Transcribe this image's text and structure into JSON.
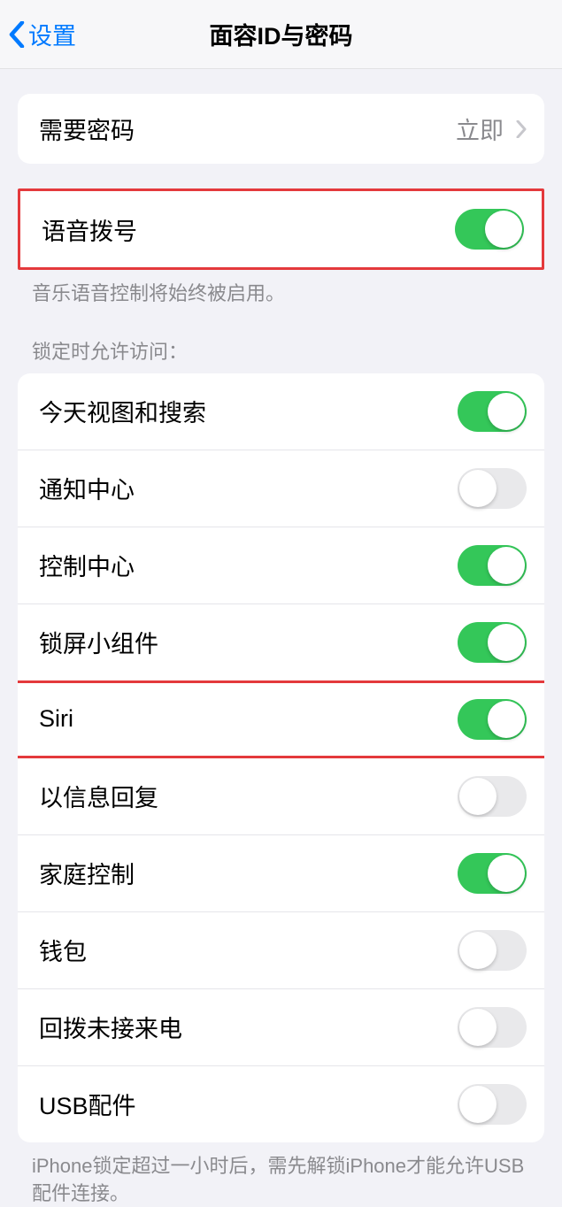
{
  "nav": {
    "back": "设置",
    "title": "面容ID与密码"
  },
  "passcode_row": {
    "label": "需要密码",
    "value": "立即"
  },
  "voice_dial": {
    "label": "语音拨号",
    "on": true
  },
  "voice_footer": "音乐语音控制将始终被启用。",
  "lock_header": "锁定时允许访问：",
  "lock_items": [
    {
      "label": "今天视图和搜索",
      "on": true,
      "highlighted": false
    },
    {
      "label": "通知中心",
      "on": false,
      "highlighted": false
    },
    {
      "label": "控制中心",
      "on": true,
      "highlighted": false
    },
    {
      "label": "锁屏小组件",
      "on": true,
      "highlighted": false
    },
    {
      "label": "Siri",
      "on": true,
      "highlighted": true
    },
    {
      "label": "以信息回复",
      "on": false,
      "highlighted": false
    },
    {
      "label": "家庭控制",
      "on": true,
      "highlighted": false
    },
    {
      "label": "钱包",
      "on": false,
      "highlighted": false
    },
    {
      "label": "回拨未接来电",
      "on": false,
      "highlighted": false
    },
    {
      "label": "USB配件",
      "on": false,
      "highlighted": false
    }
  ],
  "usb_footer": "iPhone锁定超过一小时后，需先解锁iPhone才能允许USB配件连接。"
}
